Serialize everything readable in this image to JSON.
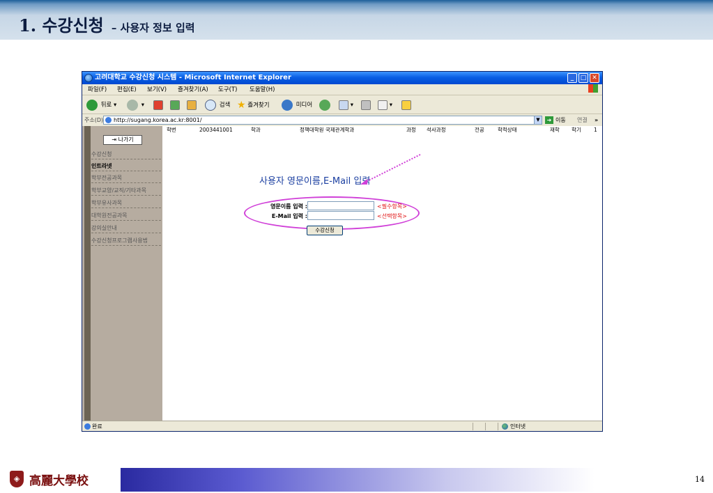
{
  "slide": {
    "title": "1. 수강신청",
    "subtitle": "– 사용자 정보 입력",
    "university": "高麗大學校",
    "page_number": "14"
  },
  "browser": {
    "window_title": "고려대학교 수강신청 시스템 - Microsoft Internet Explorer",
    "menu": [
      "파일(F)",
      "편집(E)",
      "보기(V)",
      "즐겨찾기(A)",
      "도구(T)",
      "도움말(H)"
    ],
    "toolbar": {
      "back": "뒤로",
      "search": "검색",
      "favorites": "즐겨찾기",
      "media": "미디어"
    },
    "address_label": "주소(D)",
    "url": "http://sugang.korea.ac.kr:8001/",
    "go_label": "이동",
    "links_label": "연결",
    "links_more": "»",
    "status_text": "완료",
    "zone_label": "인터넷"
  },
  "page": {
    "back_button": "나가기",
    "sidebar_items": [
      {
        "label": "수강신청"
      },
      {
        "label": "인트라넷"
      },
      {
        "label": "학부전공과목"
      },
      {
        "label": "학부교양/교직/기타과목"
      },
      {
        "label": "학부유사과목"
      },
      {
        "label": "대학원전공과목"
      },
      {
        "label": "강의실안내"
      },
      {
        "label": "수강신청프로그램사용법"
      }
    ],
    "info_bar": {
      "student_id_label": "학번",
      "student_id": "2003441001",
      "dept_label": "학과",
      "dept": "정책대학원 국제관계학과",
      "course_label": "과정",
      "course": "석사과정",
      "major_label": "전공",
      "status_label": "학적상태",
      "status": "재학",
      "semester_label": "학기",
      "semester": "1"
    },
    "form": {
      "heading": "사용자 영문이름,E-Mail 입력",
      "english_name_label": "영문이름 입력 :",
      "english_name_note": "<필수항목>",
      "email_label": "E-Mail 입력 :",
      "email_note": "<선택항목>",
      "submit_label": "수강신청"
    }
  },
  "colors": {
    "annotation": "#d040d8",
    "heading": "#1a3ea0",
    "note": "#e01010"
  }
}
